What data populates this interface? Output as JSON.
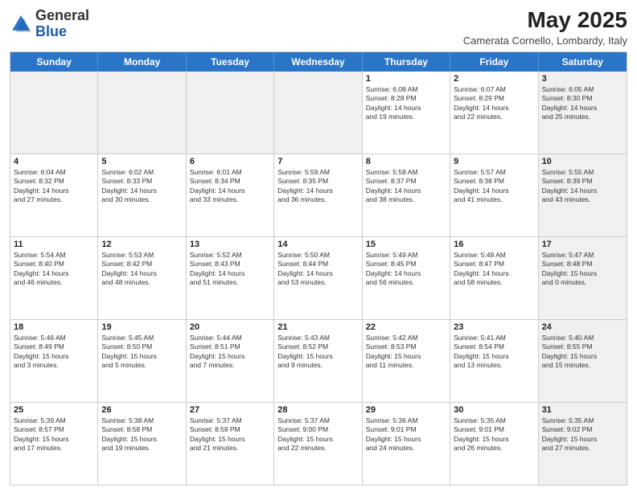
{
  "header": {
    "logo_general": "General",
    "logo_blue": "Blue",
    "month_title": "May 2025",
    "location": "Camerata Cornello, Lombardy, Italy"
  },
  "days_of_week": [
    "Sunday",
    "Monday",
    "Tuesday",
    "Wednesday",
    "Thursday",
    "Friday",
    "Saturday"
  ],
  "weeks": [
    [
      {
        "day": "",
        "text": "",
        "shaded": true
      },
      {
        "day": "",
        "text": "",
        "shaded": true
      },
      {
        "day": "",
        "text": "",
        "shaded": true
      },
      {
        "day": "",
        "text": "",
        "shaded": true
      },
      {
        "day": "1",
        "text": "Sunrise: 6:08 AM\nSunset: 8:28 PM\nDaylight: 14 hours\nand 19 minutes.",
        "shaded": false
      },
      {
        "day": "2",
        "text": "Sunrise: 6:07 AM\nSunset: 8:29 PM\nDaylight: 14 hours\nand 22 minutes.",
        "shaded": false
      },
      {
        "day": "3",
        "text": "Sunrise: 6:05 AM\nSunset: 8:30 PM\nDaylight: 14 hours\nand 25 minutes.",
        "shaded": true
      }
    ],
    [
      {
        "day": "4",
        "text": "Sunrise: 6:04 AM\nSunset: 8:32 PM\nDaylight: 14 hours\nand 27 minutes.",
        "shaded": false
      },
      {
        "day": "5",
        "text": "Sunrise: 6:02 AM\nSunset: 8:33 PM\nDaylight: 14 hours\nand 30 minutes.",
        "shaded": false
      },
      {
        "day": "6",
        "text": "Sunrise: 6:01 AM\nSunset: 8:34 PM\nDaylight: 14 hours\nand 33 minutes.",
        "shaded": false
      },
      {
        "day": "7",
        "text": "Sunrise: 5:59 AM\nSunset: 8:35 PM\nDaylight: 14 hours\nand 36 minutes.",
        "shaded": false
      },
      {
        "day": "8",
        "text": "Sunrise: 5:58 AM\nSunset: 8:37 PM\nDaylight: 14 hours\nand 38 minutes.",
        "shaded": false
      },
      {
        "day": "9",
        "text": "Sunrise: 5:57 AM\nSunset: 8:38 PM\nDaylight: 14 hours\nand 41 minutes.",
        "shaded": false
      },
      {
        "day": "10",
        "text": "Sunrise: 5:55 AM\nSunset: 8:39 PM\nDaylight: 14 hours\nand 43 minutes.",
        "shaded": true
      }
    ],
    [
      {
        "day": "11",
        "text": "Sunrise: 5:54 AM\nSunset: 8:40 PM\nDaylight: 14 hours\nand 46 minutes.",
        "shaded": false
      },
      {
        "day": "12",
        "text": "Sunrise: 5:53 AM\nSunset: 8:42 PM\nDaylight: 14 hours\nand 48 minutes.",
        "shaded": false
      },
      {
        "day": "13",
        "text": "Sunrise: 5:52 AM\nSunset: 8:43 PM\nDaylight: 14 hours\nand 51 minutes.",
        "shaded": false
      },
      {
        "day": "14",
        "text": "Sunrise: 5:50 AM\nSunset: 8:44 PM\nDaylight: 14 hours\nand 53 minutes.",
        "shaded": false
      },
      {
        "day": "15",
        "text": "Sunrise: 5:49 AM\nSunset: 8:45 PM\nDaylight: 14 hours\nand 56 minutes.",
        "shaded": false
      },
      {
        "day": "16",
        "text": "Sunrise: 5:48 AM\nSunset: 8:47 PM\nDaylight: 14 hours\nand 58 minutes.",
        "shaded": false
      },
      {
        "day": "17",
        "text": "Sunrise: 5:47 AM\nSunset: 8:48 PM\nDaylight: 15 hours\nand 0 minutes.",
        "shaded": true
      }
    ],
    [
      {
        "day": "18",
        "text": "Sunrise: 5:46 AM\nSunset: 8:49 PM\nDaylight: 15 hours\nand 3 minutes.",
        "shaded": false
      },
      {
        "day": "19",
        "text": "Sunrise: 5:45 AM\nSunset: 8:50 PM\nDaylight: 15 hours\nand 5 minutes.",
        "shaded": false
      },
      {
        "day": "20",
        "text": "Sunrise: 5:44 AM\nSunset: 8:51 PM\nDaylight: 15 hours\nand 7 minutes.",
        "shaded": false
      },
      {
        "day": "21",
        "text": "Sunrise: 5:43 AM\nSunset: 8:52 PM\nDaylight: 15 hours\nand 9 minutes.",
        "shaded": false
      },
      {
        "day": "22",
        "text": "Sunrise: 5:42 AM\nSunset: 8:53 PM\nDaylight: 15 hours\nand 11 minutes.",
        "shaded": false
      },
      {
        "day": "23",
        "text": "Sunrise: 5:41 AM\nSunset: 8:54 PM\nDaylight: 15 hours\nand 13 minutes.",
        "shaded": false
      },
      {
        "day": "24",
        "text": "Sunrise: 5:40 AM\nSunset: 8:55 PM\nDaylight: 15 hours\nand 15 minutes.",
        "shaded": true
      }
    ],
    [
      {
        "day": "25",
        "text": "Sunrise: 5:39 AM\nSunset: 8:57 PM\nDaylight: 15 hours\nand 17 minutes.",
        "shaded": false
      },
      {
        "day": "26",
        "text": "Sunrise: 5:38 AM\nSunset: 8:58 PM\nDaylight: 15 hours\nand 19 minutes.",
        "shaded": false
      },
      {
        "day": "27",
        "text": "Sunrise: 5:37 AM\nSunset: 8:59 PM\nDaylight: 15 hours\nand 21 minutes.",
        "shaded": false
      },
      {
        "day": "28",
        "text": "Sunrise: 5:37 AM\nSunset: 9:00 PM\nDaylight: 15 hours\nand 22 minutes.",
        "shaded": false
      },
      {
        "day": "29",
        "text": "Sunrise: 5:36 AM\nSunset: 9:01 PM\nDaylight: 15 hours\nand 24 minutes.",
        "shaded": false
      },
      {
        "day": "30",
        "text": "Sunrise: 5:35 AM\nSunset: 9:01 PM\nDaylight: 15 hours\nand 26 minutes.",
        "shaded": false
      },
      {
        "day": "31",
        "text": "Sunrise: 5:35 AM\nSunset: 9:02 PM\nDaylight: 15 hours\nand 27 minutes.",
        "shaded": true
      }
    ]
  ]
}
